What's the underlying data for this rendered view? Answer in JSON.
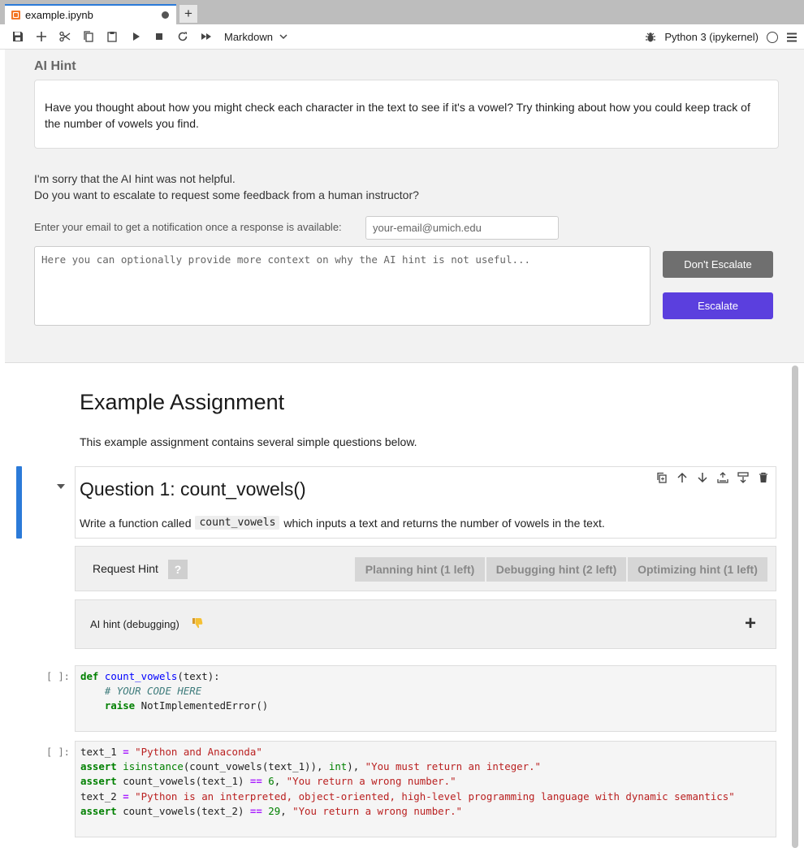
{
  "tab": {
    "title": "example.ipynb",
    "new_tab": "+"
  },
  "toolbar": {
    "cell_type": "Markdown",
    "kernel": "Python 3 (ipykernel)"
  },
  "hint_panel": {
    "heading": "AI Hint",
    "hint_text": "Have you thought about how you might check each character in the text to see if it's a vowel? Try thinking about how you could keep track of the number of vowels you find.",
    "sorry_line1": "I'm sorry that the AI hint was not helpful.",
    "sorry_line2": "Do you want to escalate to request some feedback from a human instructor?",
    "email_label": "Enter your email to get a notification once a response is available:",
    "email_placeholder": "your-email@umich.edu",
    "context_placeholder": "Here you can optionally provide more context on why the AI hint is not useful...",
    "dont_escalate": "Don't Escalate",
    "escalate": "Escalate"
  },
  "notebook": {
    "title": "Example Assignment",
    "intro": "This example assignment contains several simple questions below.",
    "question": {
      "title": "Question 1: count_vowels()",
      "text_before": "Write a function called",
      "code": "count_vowels",
      "text_after": "which inputs a text and returns the number of vowels in the text."
    },
    "request_hint": {
      "label": "Request Hint",
      "help": "?",
      "buttons": [
        "Planning hint (1 left)",
        "Debugging hint (2 left)",
        "Optimizing hint (1 left)"
      ]
    },
    "ai_hint_debug": {
      "label": "AI hint (debugging)",
      "expand": "+"
    },
    "prompt1": "[ ]:",
    "prompt2": "[ ]:"
  }
}
